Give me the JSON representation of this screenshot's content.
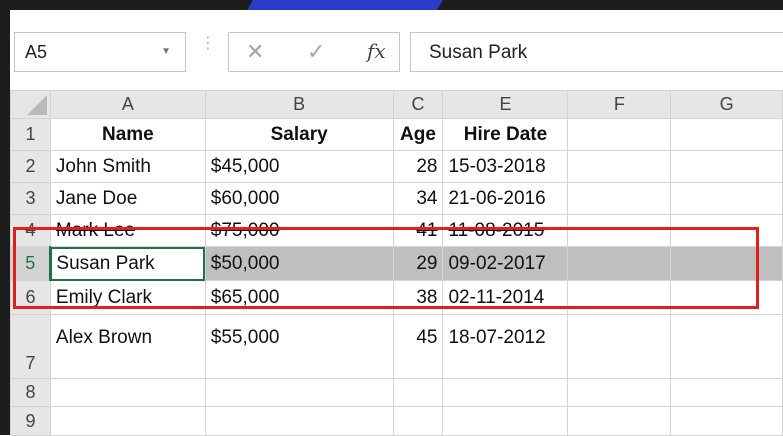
{
  "formula_bar": {
    "name_box": "A5",
    "formula": "Susan Park",
    "fx_label": "fx"
  },
  "columns": [
    "A",
    "B",
    "C",
    "E",
    "F",
    "G"
  ],
  "rows": [
    {
      "num": "1",
      "name": "Name",
      "salary": "Salary",
      "age": "Age",
      "hire": "Hire Date"
    },
    {
      "num": "2",
      "name": "John Smith",
      "salary": "$45,000",
      "age": "28",
      "hire": "15-03-2018"
    },
    {
      "num": "3",
      "name": "Jane Doe",
      "salary": "$60,000",
      "age": "34",
      "hire": "21-06-2016"
    },
    {
      "num": "4",
      "name": "Mark Lee",
      "salary": "$75,000",
      "age": "41",
      "hire": "11-08-2015"
    },
    {
      "num": "5",
      "name": "Susan Park",
      "salary": "$50,000",
      "age": "29",
      "hire": "09-02-2017"
    },
    {
      "num": "6",
      "name": "Emily Clark",
      "salary": "$65,000",
      "age": "38",
      "hire": "02-11-2014"
    },
    {
      "num": "7",
      "name": "Alex Brown",
      "salary": "$55,000",
      "age": "45",
      "hire": "18-07-2012"
    },
    {
      "num": "8"
    },
    {
      "num": "9"
    }
  ],
  "colors": {
    "selection_green": "#217346",
    "highlight_red": "#e0201a",
    "selected_row_fill": "#bfbfbf"
  }
}
